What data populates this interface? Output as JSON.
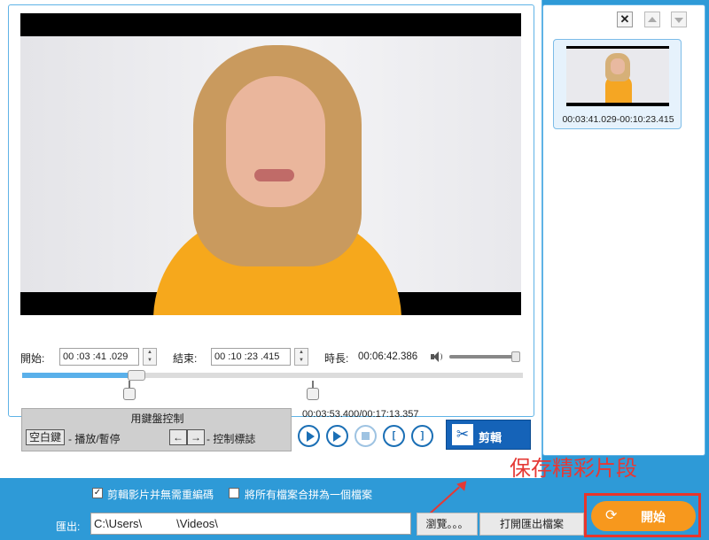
{
  "time": {
    "start_label": "開始:",
    "start_value": "00 :03 :41 .029",
    "end_label": "結束:",
    "end_value": "00 :10 :23 .415",
    "duration_label": "時長:",
    "duration_value": "00:06:42.386",
    "position": "00:03:53.400/00:17:13.357"
  },
  "keyboard": {
    "title": "用鍵盤控制",
    "space_key": "空白鍵",
    "space_desc": "- 播放/暫停",
    "arrow_desc": "- 控制標誌"
  },
  "cut_button": "剪輯",
  "clip": {
    "range": "00:03:41.029-00:10:23.415"
  },
  "annotation": "保存精彩片段",
  "options": {
    "no_reencode": "剪輯影片并無需重編碼",
    "merge": "將所有檔案合拼為一個檔案",
    "no_reencode_checked": true,
    "merge_checked": false
  },
  "output": {
    "label": "匯出:",
    "path": "C:\\Users\\   \\Videos\\",
    "browse": "瀏覽。。。",
    "open_folder": "打開匯出檔案"
  },
  "start_button": "開始",
  "colors": {
    "accent": "#1e8fe0",
    "orange": "#f7981d",
    "highlight_red": "#e8352b",
    "annotation_red": "#e53935"
  },
  "volume_level": 1.0,
  "progress": {
    "marker_left": 0.214,
    "marker_right": 0.581,
    "played": 0.225
  }
}
